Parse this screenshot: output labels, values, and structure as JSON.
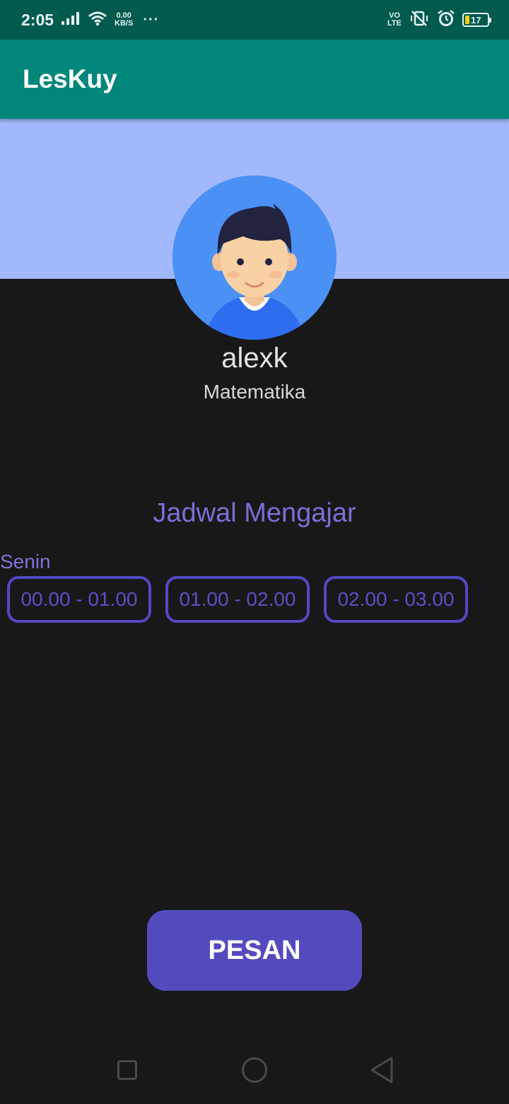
{
  "status_bar": {
    "time": "2:05",
    "speed_value": "0.00",
    "speed_unit": "KB/S",
    "more": "···",
    "volte_top": "VO",
    "volte_bottom": "LTE",
    "battery_level": "17",
    "battery_color": "#f3d21a"
  },
  "app_bar": {
    "title": "LesKuy"
  },
  "profile": {
    "name": "alexk",
    "subject": "Matematika"
  },
  "schedule": {
    "title": "Jadwal Mengajar",
    "day": "Senin",
    "slots": [
      "00.00 - 01.00",
      "01.00 - 02.00",
      "02.00 - 03.00"
    ]
  },
  "actions": {
    "book_label": "PESAN"
  },
  "colors": {
    "status_bar": "#015a4e",
    "app_bar": "#01877a",
    "header_band": "#a1b8fd",
    "accent": "#534bbd",
    "background": "#181818"
  }
}
